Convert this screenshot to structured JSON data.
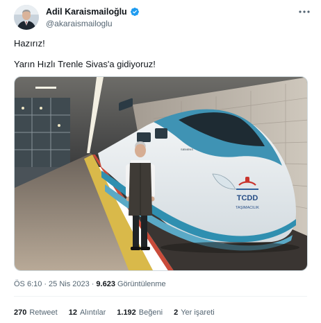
{
  "author": {
    "name": "Adil Karaismailoğlu",
    "handle": "@akaraismailoglu"
  },
  "tweet": {
    "line1": "Hazırız!",
    "line2": "Yarın Hızlı Trenle Sivas'a gidiyoruz!"
  },
  "media": {
    "train_brand": "TCDD",
    "train_sub": "TAŞIMACILIK",
    "maker": "SIEMENS"
  },
  "meta": {
    "time": "ÖS 6:10",
    "sep1": "·",
    "date": "25 Nis 2023",
    "sep2": "·",
    "views_count": "9.623",
    "views_label": "Görüntülenme"
  },
  "stats": {
    "retweets_count": "270",
    "retweets_label": "Retweet",
    "quotes_count": "12",
    "quotes_label": "Alıntılar",
    "likes_count": "1.192",
    "likes_label": "Beğeni",
    "bookmarks_count": "2",
    "bookmarks_label": "Yer işareti"
  },
  "colors": {
    "verified": "#1d9bf0",
    "muted_text": "#536471",
    "main_text": "#0f1419",
    "train_teal": "#2f8fb0"
  }
}
